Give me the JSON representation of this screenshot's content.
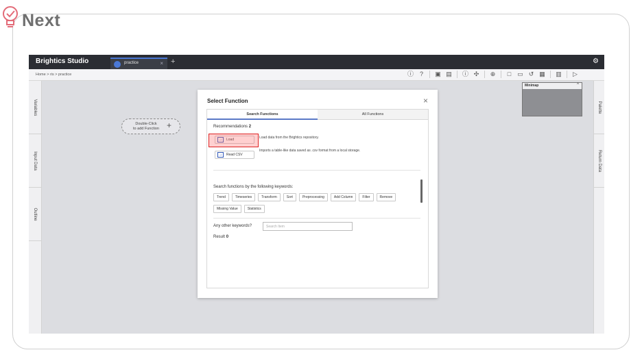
{
  "brand": {
    "name": "Next"
  },
  "app": {
    "title": "Brightics Studio",
    "tab_label": "practice",
    "tab_close": "×",
    "tab_add": "+",
    "breadcrumb": "Home > ris > practice",
    "settings_icon": "gear-icon"
  },
  "toolbar": {
    "icons": [
      "info-icon",
      "help-icon",
      "copy-icon",
      "paste-icon",
      "info-icon",
      "move-icon",
      "zoom-icon",
      "new-file-icon",
      "folder-icon",
      "history-icon",
      "calendar-icon",
      "save-icon",
      "run-icon"
    ]
  },
  "left_panel": {
    "tabs": [
      "Variables",
      "Input Data",
      "Outline"
    ]
  },
  "right_panel": {
    "tabs": [
      "Palette",
      "Return Data"
    ]
  },
  "canvas": {
    "hint_line1": "Double-Click",
    "hint_line2": "to add Function",
    "hint_plus": "+"
  },
  "minimap": {
    "title": "Minimap",
    "toggle": "^"
  },
  "dialog": {
    "title": "Select Function",
    "close": "×",
    "tabs": [
      "Search Functions",
      "All Functions"
    ],
    "recommendations_label": "Recommendations",
    "recommendations_count": "2",
    "functions": [
      {
        "label": "Load",
        "description": "Load data from the Brightics repository."
      },
      {
        "label": "Read CSV",
        "description": "Imports a table-like data saved as .csv format from a local storage."
      }
    ],
    "keywords_title": "Search functions by the following keywords:",
    "keywords_row1": [
      "Trend",
      "Timeseries",
      "Transform",
      "Sort",
      "Preprocessing",
      "Add Column",
      "Filter",
      "Remove"
    ],
    "keywords_row2": [
      "Missing Value",
      "Statistics"
    ],
    "other_keywords_label": "Any other keywords?",
    "search_placeholder": "Search Item",
    "result_label": "Result",
    "result_count": "0"
  },
  "colors": {
    "titlebar": "#2b2d33",
    "accent": "#4a78d6",
    "highlight": "#d22222"
  }
}
